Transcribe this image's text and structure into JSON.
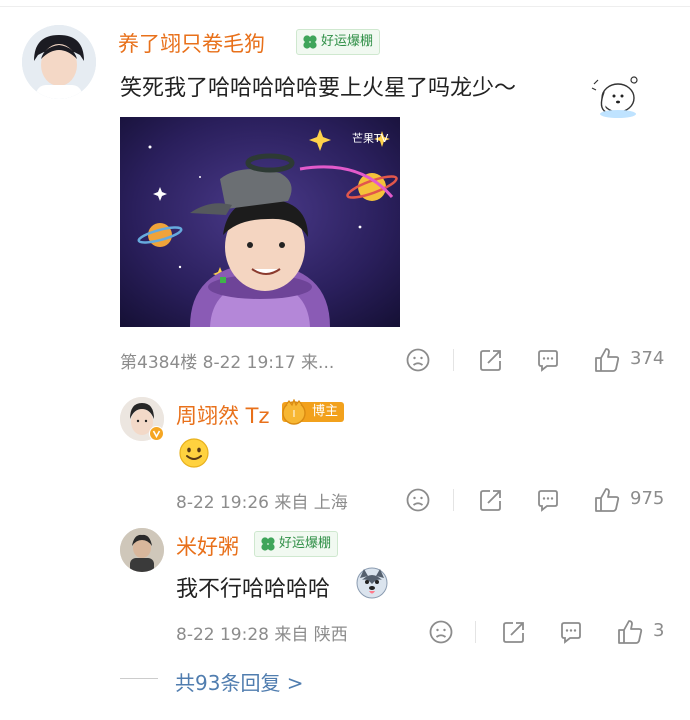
{
  "comment": {
    "username": "养了翊只卷毛狗",
    "badge": "好运爆棚",
    "text": "笑死我了哈哈哈哈哈要上火星了吗龙少～",
    "image_watermark": "芒果TV",
    "meta": "第4384楼 8-22 19:17 来...",
    "likes": "374"
  },
  "replies": [
    {
      "username": "周翊然 Tz",
      "badge": "博主",
      "meta": "8-22 19:26 来自 上海",
      "likes": "975"
    },
    {
      "username": "米好粥",
      "badge": "好运爆棚",
      "text": "我不行哈哈哈哈",
      "meta": "8-22 19:28 来自 陕西",
      "likes": "3"
    }
  ],
  "more_replies": "共93条回复 >",
  "colors": {
    "username": "#e8701a",
    "link": "#507daf",
    "meta": "#8c8c8c",
    "badge_green": "#2f8f46",
    "blogger_orange": "#f2a11c"
  }
}
